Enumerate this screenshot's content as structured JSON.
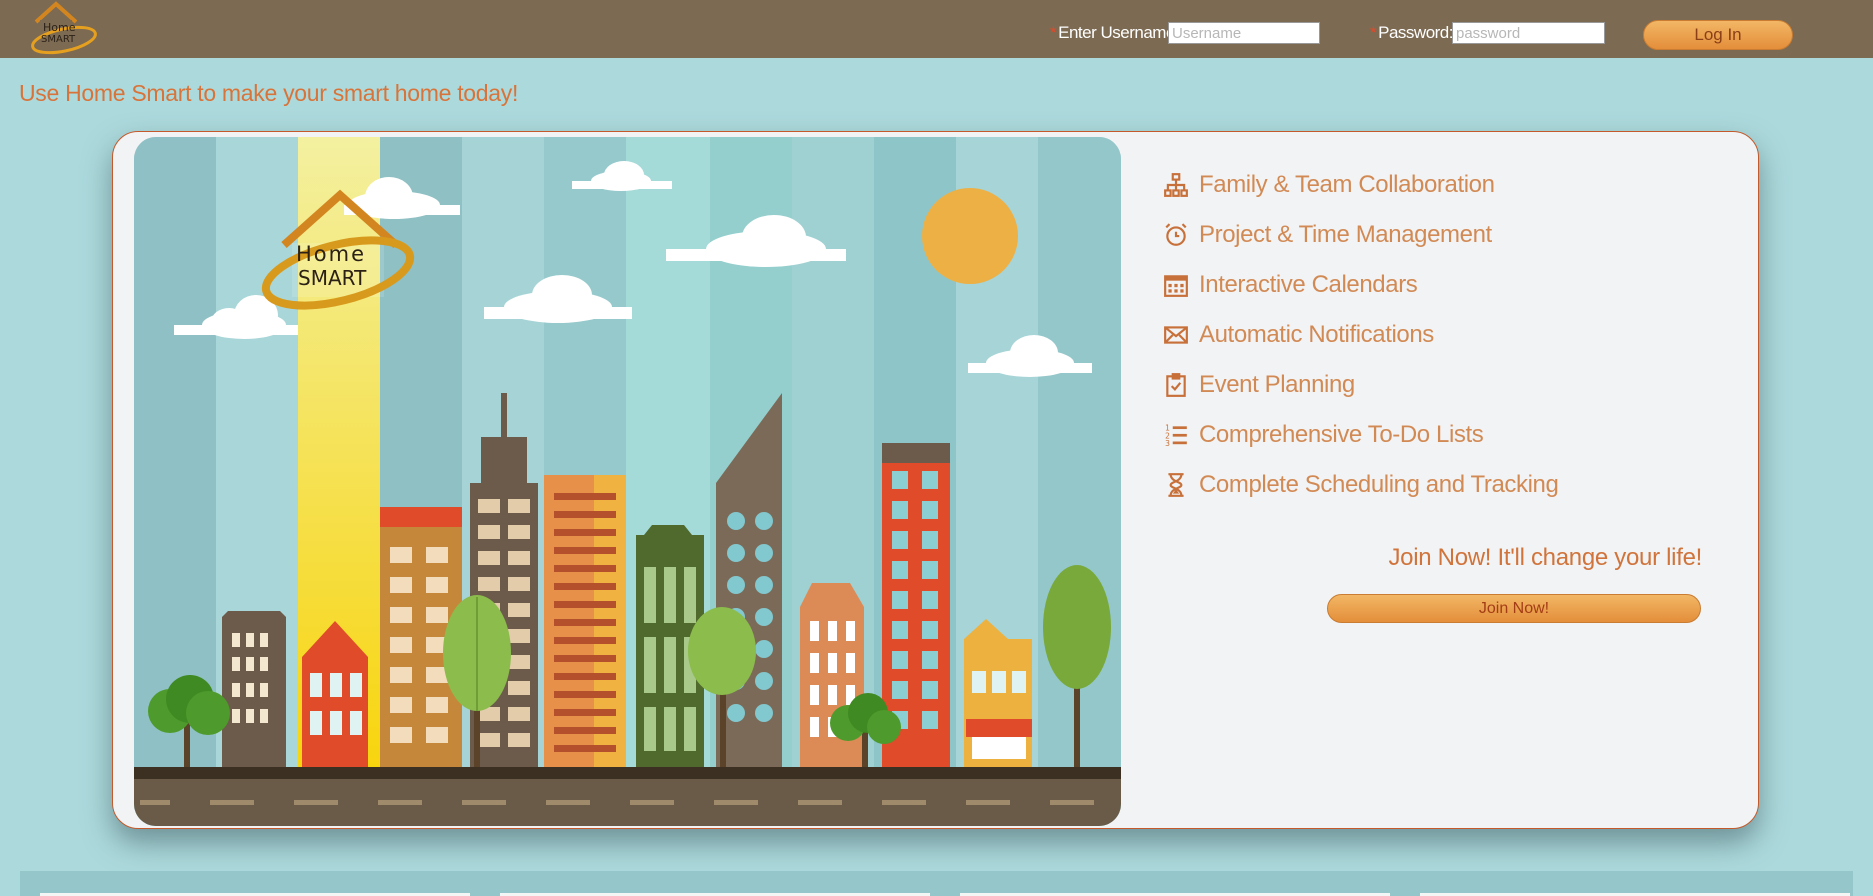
{
  "brand": {
    "logo_word_1": "Home",
    "logo_word_2": "SMART"
  },
  "login": {
    "username_label": "Enter Username",
    "username_placeholder": "Username",
    "password_label": "Password:",
    "password_placeholder": "password",
    "required_marker": "*",
    "button_label": "Log In"
  },
  "tagline": "Use Home Smart to make your smart home today!",
  "features": [
    {
      "icon": "sitemap-icon",
      "label": "Family & Team Collaboration"
    },
    {
      "icon": "alarm-clock-icon",
      "label": "Project & Time Management"
    },
    {
      "icon": "calendar-icon",
      "label": "Interactive Calendars"
    },
    {
      "icon": "envelope-icon",
      "label": "Automatic Notifications"
    },
    {
      "icon": "clipboard-check-icon",
      "label": "Event Planning"
    },
    {
      "icon": "numbered-list-icon",
      "label": "Comprehensive To-Do Lists"
    },
    {
      "icon": "hourglass-icon",
      "label": "Complete Scheduling and Tracking"
    }
  ],
  "join": {
    "headline": "Join Now! It'll change your life!",
    "button_label": "Join Now!"
  },
  "colors": {
    "topbar": "#7c6a52",
    "page_bg": "#acd9dc",
    "accent_orange": "#d28a55",
    "card_border": "#c45a2c",
    "button_gradient_top": "#f2b765",
    "button_gradient_bottom": "#e48e3a"
  }
}
